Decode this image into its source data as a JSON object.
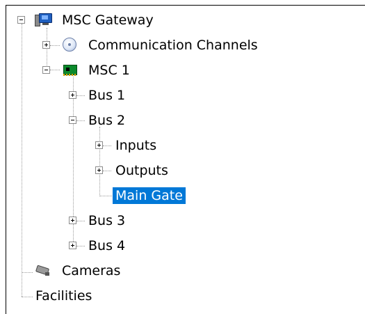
{
  "tree": {
    "root": {
      "label": "MSC Gateway",
      "icon": "computer-network-icon",
      "expanded": true
    },
    "communication_channels": {
      "label": "Communication Channels",
      "icon": "disc-icon",
      "expanded": false
    },
    "msc1": {
      "label": "MSC 1",
      "icon": "circuit-board-icon",
      "expanded": true
    },
    "bus1": {
      "label": "Bus 1",
      "expanded": false
    },
    "bus2": {
      "label": "Bus 2",
      "expanded": true
    },
    "inputs": {
      "label": "Inputs",
      "expanded": false
    },
    "outputs": {
      "label": "Outputs",
      "expanded": false
    },
    "main_gate": {
      "label": "Main Gate",
      "selected": true
    },
    "bus3": {
      "label": "Bus 3",
      "expanded": false
    },
    "bus4": {
      "label": "Bus 4",
      "expanded": false
    },
    "cameras": {
      "label": "Cameras",
      "icon": "security-camera-icon"
    },
    "facilities": {
      "label": "Facilities"
    }
  },
  "colors": {
    "selection_background": "#0078d7",
    "selection_text": "#ffffff",
    "connector": "#9a9a9a"
  }
}
